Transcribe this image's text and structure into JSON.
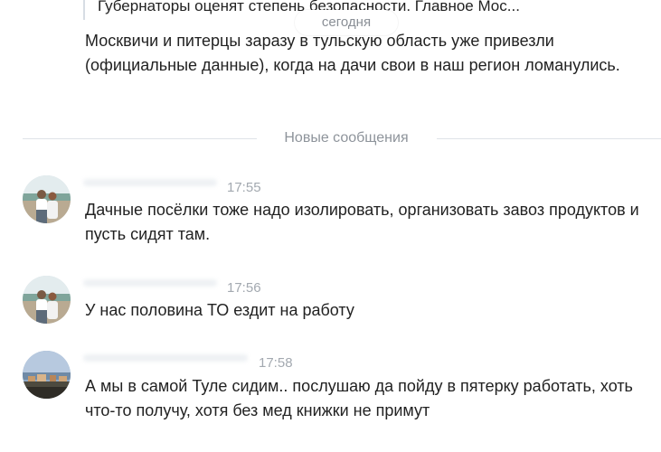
{
  "chat": {
    "quoted_line": "Губернаторы оценят степень безопасности. Главное Мос...",
    "date_separator": "сегодня",
    "first_message": "Москвичи и питерцы заразу в тульскую область уже привезли (официальные данные), когда на дачи свои в наш регион ломанулись.",
    "new_messages_label": "Новые сообщения",
    "messages": [
      {
        "time": "17:55",
        "text": "Дачные посёлки тоже надо изолировать, организовать завоз продуктов и пусть сидят там."
      },
      {
        "time": "17:56",
        "text": "У нас половина ТО ездит на работу"
      },
      {
        "time": "17:58",
        "text": "А мы в самой Туле сидим.. послушаю да пойду в пятерку работать, хоть что-то получу, хотя без мед книжки не примут"
      }
    ]
  },
  "colors": {
    "text": "#222222",
    "muted": "#8e949b",
    "time": "#a3a9b0",
    "divider": "#dfe3e8"
  }
}
